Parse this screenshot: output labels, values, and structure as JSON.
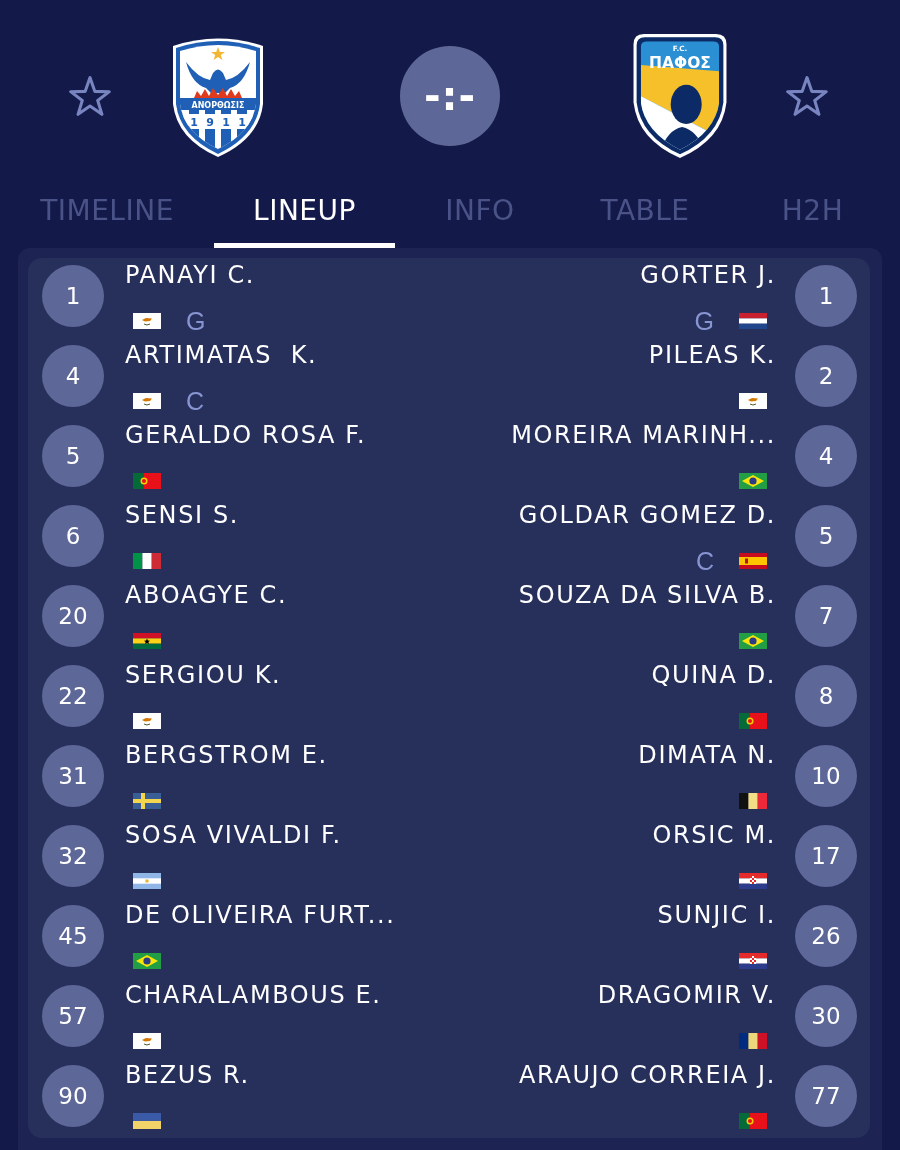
{
  "match": {
    "home": {
      "favorite": false,
      "crest": {
        "kind": "striped",
        "name": "ΑΝΟΡΘΩΣΙΣ",
        "year": "1911"
      }
    },
    "score": "-:-",
    "away": {
      "favorite": false,
      "crest": {
        "kind": "portrait",
        "prefix": "F.C.",
        "name": "ΠΑΦΟΣ"
      }
    }
  },
  "tabs": [
    {
      "label": "TIMELINE",
      "selected": false
    },
    {
      "label": "LINEUP",
      "selected": true
    },
    {
      "label": "INFO",
      "selected": false
    },
    {
      "label": "TABLE",
      "selected": false
    },
    {
      "label": "H2H",
      "selected": false
    }
  ],
  "lineup": {
    "home": [
      {
        "number": "1",
        "name": "PANAYI C.",
        "flag": {
          "kind": "cyprus"
        },
        "position": "G"
      },
      {
        "number": "4",
        "name": "ARTIMATAS  K.",
        "flag": {
          "kind": "cyprus"
        },
        "position": "C"
      },
      {
        "number": "5",
        "name": "GERALDO ROSA F.",
        "flag": {
          "kind": "portugal"
        }
      },
      {
        "number": "6",
        "name": "SENSI S.",
        "flag": {
          "kind": "italy"
        }
      },
      {
        "number": "20",
        "name": "ABOAGYE C.",
        "flag": {
          "kind": "ghana"
        }
      },
      {
        "number": "22",
        "name": "SERGIOU K.",
        "flag": {
          "kind": "cyprus"
        }
      },
      {
        "number": "31",
        "name": "BERGSTROM E.",
        "flag": {
          "kind": "sweden"
        }
      },
      {
        "number": "32",
        "name": "SOSA VIVALDI F.",
        "flag": {
          "kind": "argentina"
        }
      },
      {
        "number": "45",
        "name": "DE OLIVEIRA FURT...",
        "flag": {
          "kind": "brazil"
        }
      },
      {
        "number": "57",
        "name": "CHARALAMBOUS E.",
        "flag": {
          "kind": "cyprus"
        }
      },
      {
        "number": "90",
        "name": "BEZUS R.",
        "flag": {
          "kind": "ukraine"
        }
      }
    ],
    "away": [
      {
        "number": "1",
        "name": "GORTER J.",
        "flag": {
          "kind": "netherlands"
        },
        "position": "G"
      },
      {
        "number": "2",
        "name": "PILEAS K.",
        "flag": {
          "kind": "cyprus"
        }
      },
      {
        "number": "4",
        "name": "MOREIRA MARINH...",
        "flag": {
          "kind": "brazil"
        }
      },
      {
        "number": "5",
        "name": "GOLDAR GOMEZ D.",
        "flag": {
          "kind": "spain"
        },
        "position": "C"
      },
      {
        "number": "7",
        "name": "SOUZA DA SILVA B.",
        "flag": {
          "kind": "brazil"
        }
      },
      {
        "number": "8",
        "name": "QUINA D.",
        "flag": {
          "kind": "portugal"
        }
      },
      {
        "number": "10",
        "name": "DIMATA N.",
        "flag": {
          "kind": "belgium"
        }
      },
      {
        "number": "17",
        "name": "ORSIC M.",
        "flag": {
          "kind": "croatia"
        }
      },
      {
        "number": "26",
        "name": "SUNJIC I.",
        "flag": {
          "kind": "croatia"
        }
      },
      {
        "number": "30",
        "name": "DRAGOMIR V.",
        "flag": {
          "kind": "romania"
        }
      },
      {
        "number": "77",
        "name": "ARAUJO CORREIA J.",
        "flag": {
          "kind": "portugal"
        }
      }
    ]
  }
}
